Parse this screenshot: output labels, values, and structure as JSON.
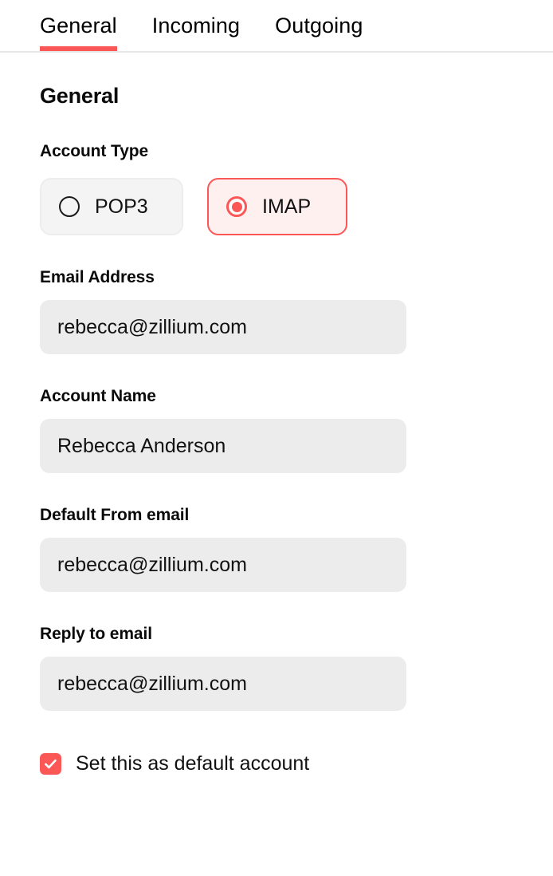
{
  "accent_color": "#fc5757",
  "tabs": [
    {
      "label": "General",
      "active": true
    },
    {
      "label": "Incoming",
      "active": false
    },
    {
      "label": "Outgoing",
      "active": false
    }
  ],
  "section": {
    "title": "General"
  },
  "account_type": {
    "label": "Account Type",
    "options": [
      {
        "label": "POP3",
        "selected": false,
        "icon": "radio-unchecked-icon"
      },
      {
        "label": "IMAP",
        "selected": true,
        "icon": "radio-checked-icon"
      }
    ]
  },
  "fields": [
    {
      "name": "email-address",
      "label": "Email Address",
      "value": "rebecca@zillium.com",
      "placeholder": "Email Address"
    },
    {
      "name": "account-name",
      "label": "Account Name",
      "value": "Rebecca Anderson",
      "placeholder": "Account Name"
    },
    {
      "name": "default-from-email",
      "label": "Default From email",
      "value": "rebecca@zillium.com",
      "placeholder": "Default From email"
    },
    {
      "name": "reply-to-email",
      "label": "Reply to email",
      "value": "rebecca@zillium.com",
      "placeholder": "Reply to email"
    }
  ],
  "default_account": {
    "label": "Set this as default account",
    "checked": true,
    "icon": "checkmark-icon"
  }
}
